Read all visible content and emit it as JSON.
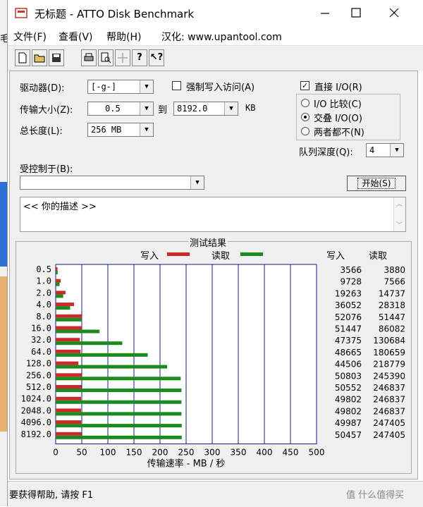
{
  "window": {
    "title": "无标题 - ATTO Disk Benchmark"
  },
  "left_edge_text": "毛",
  "menu": [
    "文件(F)",
    "查看(V)",
    "帮助(H)",
    "汉化: www.upantool.com"
  ],
  "controls": {
    "drive_label": "驱动器(D):",
    "drive_value": "[-g-]",
    "transfer_label": "传输大小(Z):",
    "transfer_from": "0.5",
    "transfer_to_label": "到",
    "transfer_to": "8192.0",
    "transfer_unit": "KB",
    "length_label": "总长度(L):",
    "length_value": "256 MB",
    "force_write_label": "强制写入访问(A)",
    "direct_io_label": "直接 I/O(R)",
    "radio_io_compare": "I/O 比较(C)",
    "radio_overlap": "交叠 I/O(O)",
    "radio_neither": "两者都不(N)",
    "queue_label": "队列深度(Q):",
    "queue_value": "4",
    "controlled_by_label": "受控制于(B):",
    "start_button": "开始(S)",
    "description_text": "<<  你的描述   >>"
  },
  "results": {
    "title": "测试结果",
    "legend_write": "写入",
    "legend_read": "读取",
    "col_write": "写入",
    "col_read": "读取",
    "xlabel": "传输速率 - MB / 秒",
    "x_ticks": [
      "0",
      "50",
      "100",
      "150",
      "200",
      "250",
      "300",
      "350",
      "400",
      "450",
      "500"
    ]
  },
  "colors": {
    "write": "#cc2a2a",
    "read": "#1d8a1d",
    "grid": "#1a1a8c"
  },
  "chart_data": {
    "type": "bar",
    "orientation": "horizontal",
    "xlim": [
      0,
      500
    ],
    "categories": [
      "0.5",
      "1.0",
      "2.0",
      "4.0",
      "8.0",
      "16.0",
      "32.0",
      "64.0",
      "128.0",
      "256.0",
      "512.0",
      "1024.0",
      "2048.0",
      "4096.0",
      "8192.0"
    ],
    "series": [
      {
        "name": "写入",
        "values": [
          3566,
          9728,
          19263,
          36052,
          52076,
          51447,
          47375,
          48665,
          44506,
          50803,
          50552,
          49802,
          49802,
          49987,
          50457
        ]
      },
      {
        "name": "读取",
        "values": [
          3880,
          7566,
          14737,
          28318,
          51447,
          86082,
          130684,
          180659,
          218779,
          245390,
          246837,
          246837,
          246837,
          247405,
          247405
        ]
      }
    ],
    "write_text": [
      "3566",
      "9728",
      "19263",
      "36052",
      "52076",
      "51447",
      "47375",
      "48665",
      "44506",
      "50803",
      "50552",
      "49802",
      "49802",
      "49987",
      "50457"
    ],
    "read_text": [
      "3880",
      "7566",
      "14737",
      "28318",
      "51447",
      "86082",
      "130684",
      "180659",
      "218779",
      "245390",
      "246837",
      "246837",
      "246837",
      "247405",
      "247405"
    ]
  },
  "statusbar": {
    "text": "要获得帮助, 请按 F1",
    "watermark": "值 什么值得买"
  }
}
